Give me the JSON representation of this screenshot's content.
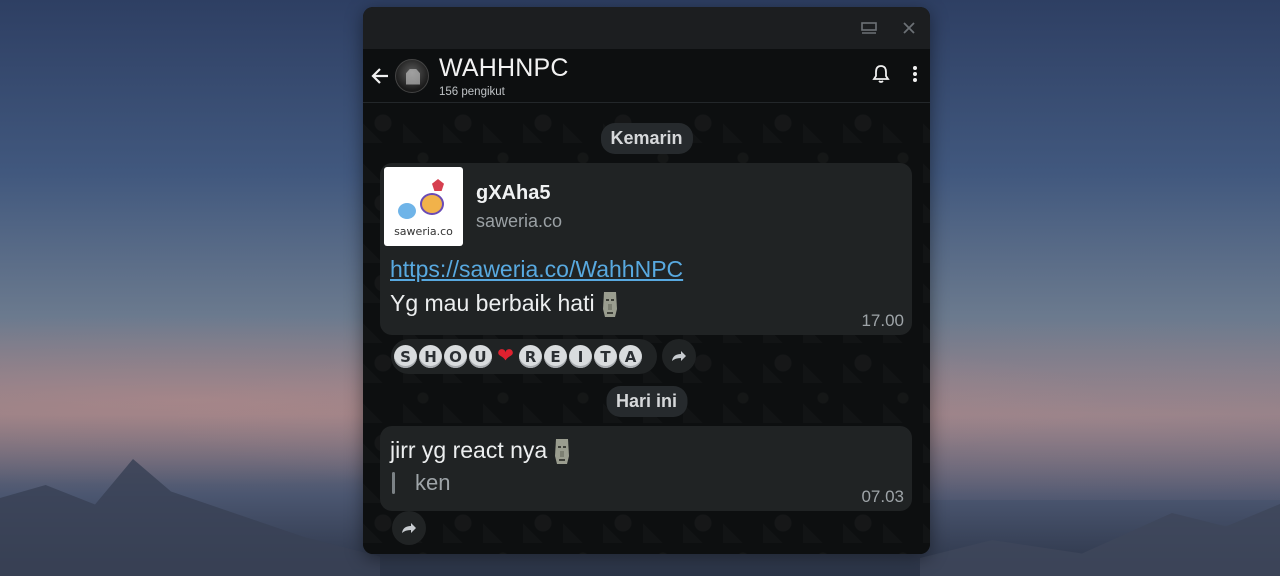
{
  "window": {
    "maximize_icon": "maximize-icon",
    "close_icon": "close-icon"
  },
  "header": {
    "title": "WAHHNPC",
    "subtitle": "156 pengikut",
    "back_icon": "back-arrow-icon",
    "bell_icon": "bell-icon",
    "menu_icon": "more-vertical-icon"
  },
  "chat": {
    "date_1": "Kemarin",
    "date_2": "Hari ini",
    "message_1": {
      "preview_title": "gXAha5",
      "preview_site": "saweria.co",
      "preview_logo_text": "saweria.co",
      "link": "https://saweria.co/WahhNPC",
      "text": "Yg mau berbaik hati",
      "time": "17.00",
      "reactions": [
        "S",
        "H",
        "O",
        "U",
        "❤",
        "R",
        "E",
        "I",
        "T",
        "A"
      ]
    },
    "message_2": {
      "text": "jirr yg react nya",
      "quote": "ken",
      "time": "07.03"
    }
  }
}
